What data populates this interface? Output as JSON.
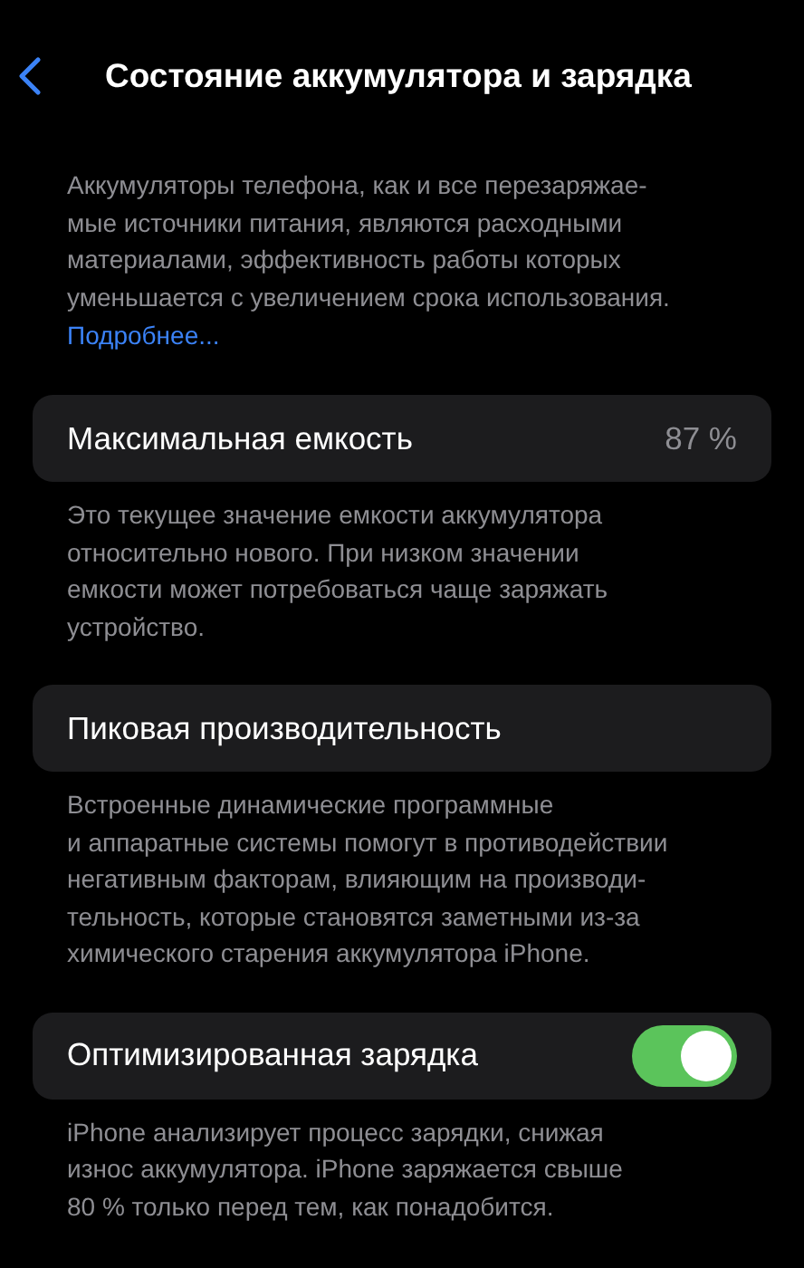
{
  "nav": {
    "title": "Состояние аккумулятора и зарядка"
  },
  "intro": {
    "lines": [
      "Аккумуляторы телефона, как и все перезаряжае-",
      "мые источники питания, являются расходными",
      "материалами, эффективность работы которых",
      "уменьшается с увеличением срока использования."
    ],
    "link": "Подробнее..."
  },
  "sections": [
    {
      "kind": "value",
      "label": "Максимальная емкость",
      "value": "87 %",
      "footer": [
        "Это текущее значение емкости аккумулятора",
        "относительно нового. При низком значении",
        "емкости может потребоваться чаще заряжать",
        "устройство."
      ]
    },
    {
      "kind": "plain",
      "label": "Пиковая производительность",
      "footer": [
        "Встроенные динамические программные",
        "и аппаратные системы помогут в противодействии",
        "негативным факторам, влияющим на производи-",
        "тельность, которые становятся заметными из-за",
        "химического старения аккумулятора iPhone."
      ]
    },
    {
      "kind": "toggle",
      "label": "Оптимизированная зарядка",
      "on": true,
      "footer": [
        "iPhone анализирует процесс зарядки, снижая",
        "износ аккумулятора. iPhone заряжается свыше",
        "80 % только перед тем, как понадобится."
      ]
    }
  ]
}
